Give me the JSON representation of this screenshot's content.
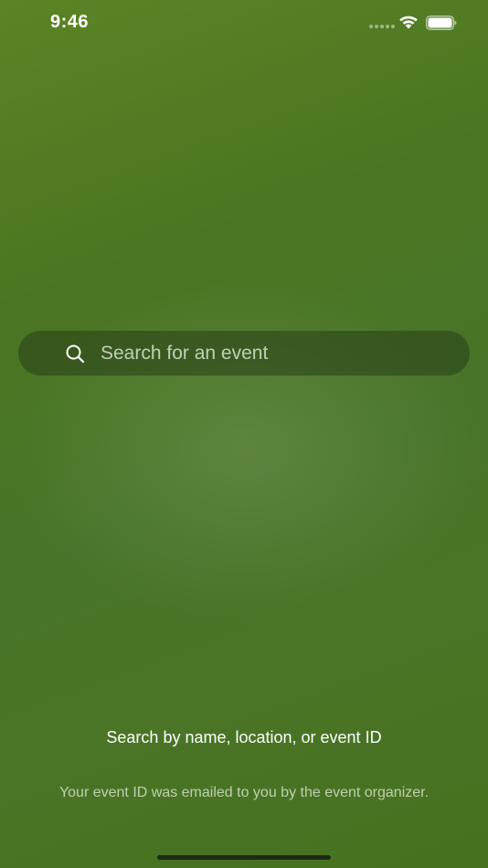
{
  "status_bar": {
    "time": "9:46",
    "signal_icon": "cellular-dots-icon",
    "wifi_icon": "wifi-icon",
    "battery_icon": "battery-icon"
  },
  "search": {
    "placeholder": "Search for an event",
    "value": "",
    "icon": "search-icon"
  },
  "hint": {
    "title": "Search by name, location, or event ID",
    "subtitle": "Your event ID was emailed to you by the event organizer."
  },
  "colors": {
    "background_top": "#5c8424",
    "background_bottom": "#46721f",
    "search_bar_bg": "#34501e",
    "text_primary": "#ffffff",
    "text_secondary": "#dfe6d5"
  }
}
